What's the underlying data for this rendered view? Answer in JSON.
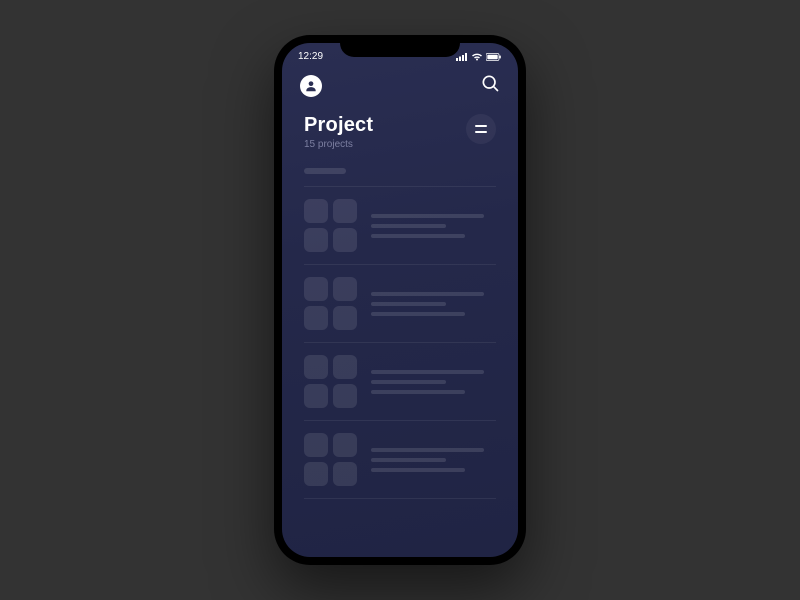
{
  "status": {
    "time": "12:29"
  },
  "header": {
    "title": "Project",
    "subtitle": "15 projects"
  }
}
